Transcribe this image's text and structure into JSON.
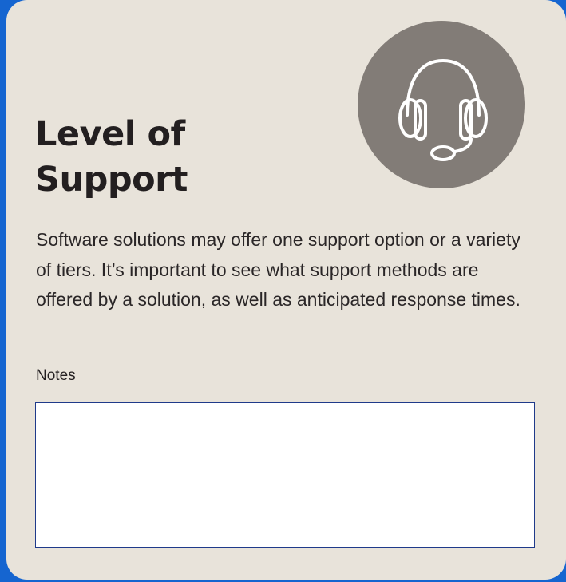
{
  "card": {
    "title_line1": "Level of",
    "title_line2": "Support",
    "icon": "headset-icon",
    "description": "Software solutions may offer one support option or a variety of tiers. It’s important to see what support methods are offered by a solution, as well as anticipat­ed response times.",
    "notes": {
      "label": "Notes",
      "value": ""
    }
  },
  "colors": {
    "background": "#1565d0",
    "card": "#e8e3da",
    "icon_circle": "#827c77",
    "field_border": "#1f3a8a"
  }
}
